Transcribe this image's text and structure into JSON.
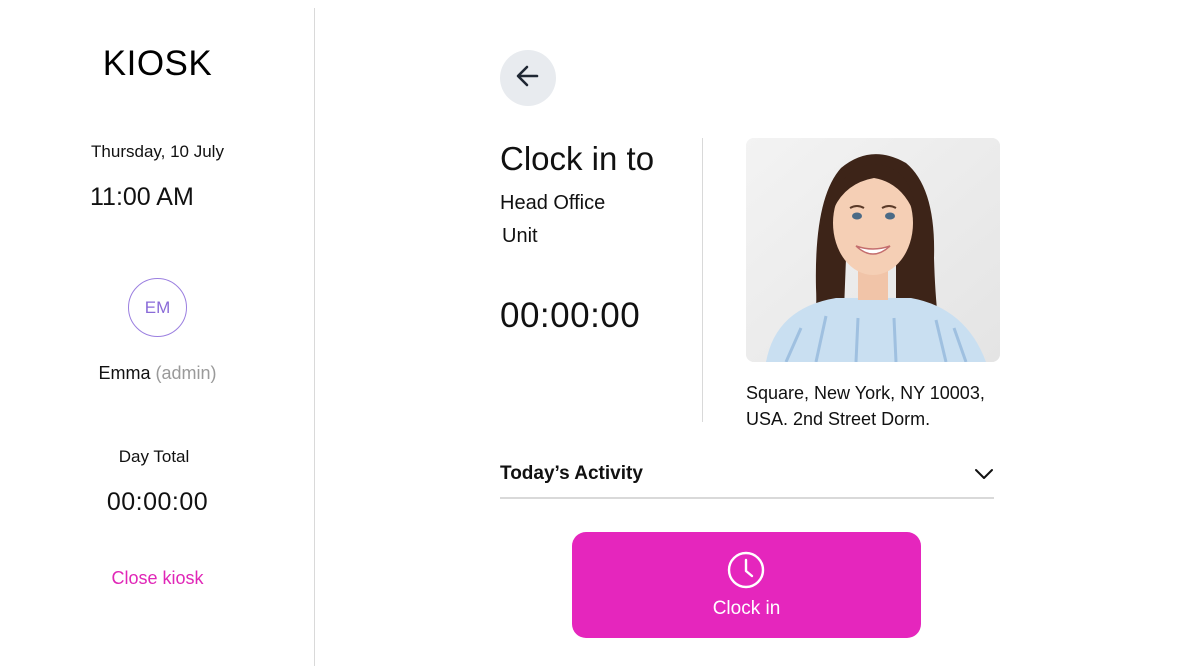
{
  "app": {
    "title": "KIOSK"
  },
  "sidebar": {
    "date": "Thursday, 10 July",
    "time": "11:00 AM",
    "user": {
      "initials": "EM",
      "name": "Emma",
      "role": "(admin)"
    },
    "day_total_label": "Day Total",
    "day_total_value": "00:00:00",
    "close_label": "Close kiosk"
  },
  "main": {
    "title": "Clock in to",
    "location": "Head Office",
    "unit": "Unit",
    "timer": "00:00:00",
    "address": "Square, New York, NY 10003, USA. 2nd Street Dorm.",
    "activity_label": "Today’s Activity",
    "clockin_label": "Clock in"
  },
  "icons": {
    "back": "arrow-left-icon",
    "chevron": "chevron-down-icon",
    "clock": "clock-icon"
  },
  "colors": {
    "accent": "#e526bd",
    "avatar": "#8a6bd8",
    "back_button_bg": "#e8ebef",
    "divider": "#d9d9d9"
  }
}
